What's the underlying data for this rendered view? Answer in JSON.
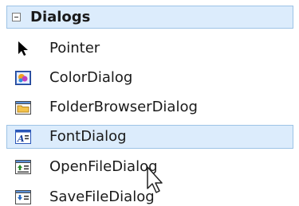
{
  "group": {
    "title": "Dialogs",
    "expanded": true
  },
  "items": [
    {
      "label": "Pointer",
      "icon": "pointer-arrow-icon"
    },
    {
      "label": "ColorDialog",
      "icon": "color-dialog-icon"
    },
    {
      "label": "FolderBrowserDialog",
      "icon": "folder-browser-icon"
    },
    {
      "label": "FontDialog",
      "icon": "font-dialog-icon",
      "selected": true
    },
    {
      "label": "OpenFileDialog",
      "icon": "open-file-dialog-icon"
    },
    {
      "label": "SaveFileDialog",
      "icon": "save-file-dialog-icon"
    }
  ],
  "colors": {
    "selection_fill": "#dcecfc",
    "selection_border": "#9dc3e6"
  }
}
